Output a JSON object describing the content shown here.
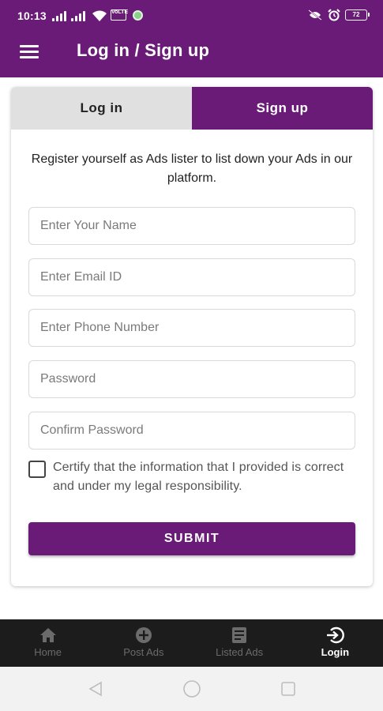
{
  "theme": {
    "brand": "#6a1b78",
    "nav_bg": "#1c1c1c"
  },
  "status_bar": {
    "time": "10:13",
    "volte": "VoLTE",
    "battery": "72"
  },
  "app_bar": {
    "title": "Log in / Sign up",
    "menu_icon": "hamburger-menu-icon"
  },
  "tabs": [
    {
      "label": "Log in",
      "selected": false
    },
    {
      "label": "Sign up",
      "selected": true
    }
  ],
  "signup": {
    "intro": "Register yourself as Ads lister to list down your Ads in our platform.",
    "fields": {
      "name_placeholder": "Enter Your Name",
      "email_placeholder": "Enter Email ID",
      "phone_placeholder": "Enter Phone Number",
      "password_placeholder": "Password",
      "confirm_placeholder": "Confirm Password"
    },
    "certify_text": "Certify that the information that I provided is correct and under my legal responsibility.",
    "certify_checked": false,
    "submit_label": "SUBMIT"
  },
  "bottom_nav": [
    {
      "label": "Home",
      "icon": "home-icon",
      "active": false
    },
    {
      "label": "Post Ads",
      "icon": "add-circle-icon",
      "active": false
    },
    {
      "label": "Listed Ads",
      "icon": "list-icon",
      "active": false
    },
    {
      "label": "Login",
      "icon": "login-icon",
      "active": true
    }
  ]
}
